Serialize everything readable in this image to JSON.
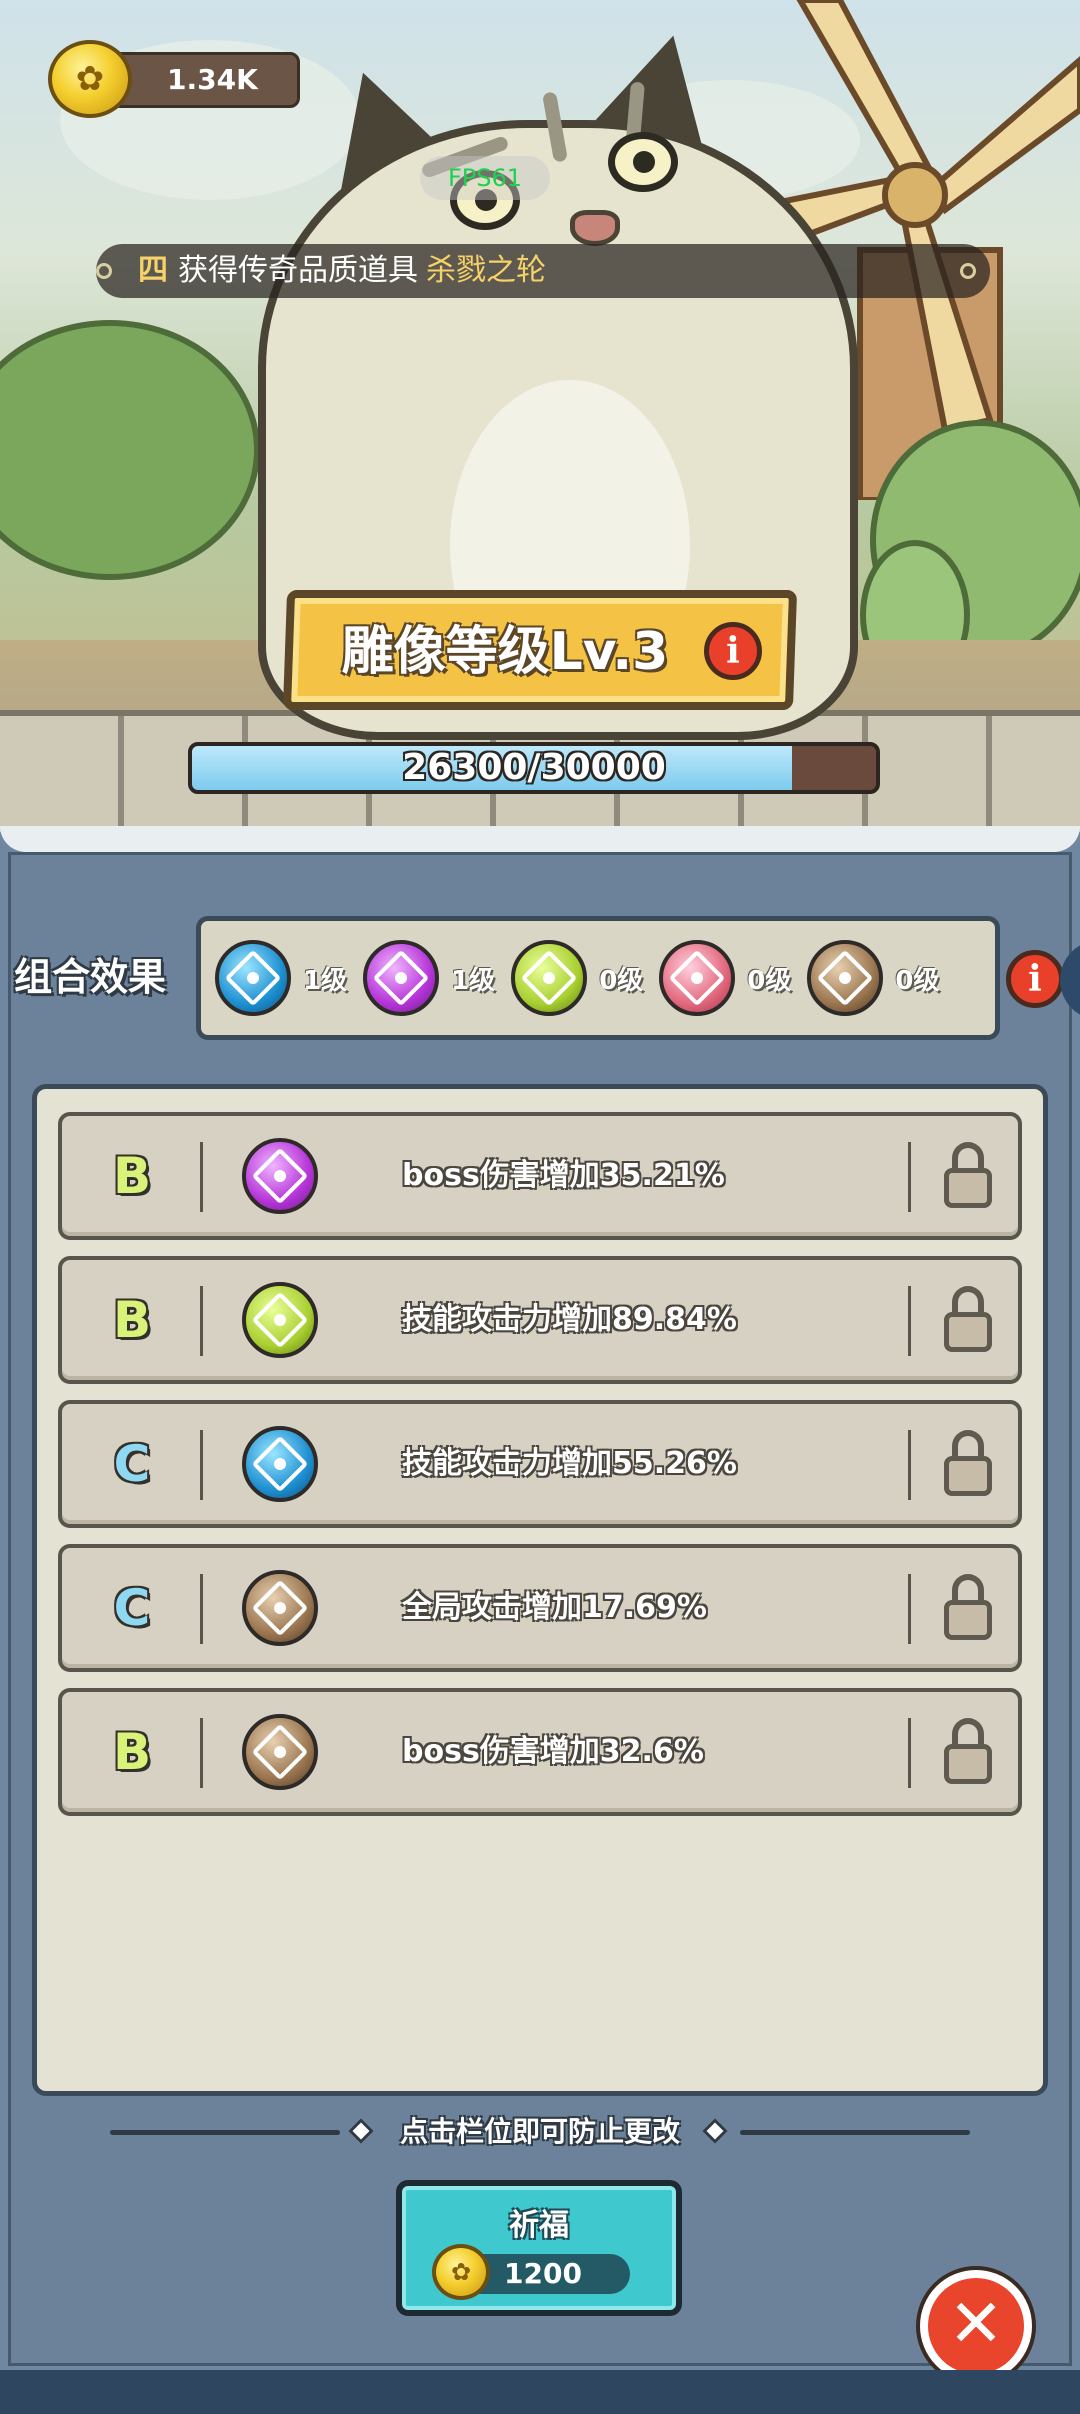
{
  "hud": {
    "coins": "1.34K",
    "fps": "FPS61",
    "notice_index": "四",
    "notice_text": "获得传奇品质道具",
    "notice_item": "杀戮之轮"
  },
  "statue": {
    "level_label": "雕像等级Lv.3",
    "exp_text": "26300/30000",
    "exp_current": 26300,
    "exp_max": 30000,
    "info_icon": "i"
  },
  "combo": {
    "title": "组合效果",
    "items": [
      {
        "icon": "blue-rune-icon",
        "level": "1级"
      },
      {
        "icon": "purple-rune-icon",
        "level": "1级"
      },
      {
        "icon": "green-rune-icon",
        "level": "0级"
      },
      {
        "icon": "pink-rune-icon",
        "level": "0级"
      },
      {
        "icon": "brown-rune-icon",
        "level": "0级"
      }
    ]
  },
  "slots": [
    {
      "grade": "B",
      "rune": "purple",
      "desc": "boss伤害增加35.21%"
    },
    {
      "grade": "B",
      "rune": "green",
      "desc": "技能攻击力增加89.84%"
    },
    {
      "grade": "C",
      "rune": "blue",
      "desc": "技能攻击力增加55.26%"
    },
    {
      "grade": "C",
      "rune": "brown",
      "desc": "全局攻击增加17.69%"
    },
    {
      "grade": "B",
      "rune": "brown",
      "desc": "boss伤害增加32.6%"
    }
  ],
  "hint": "点击栏位即可防止更改",
  "pray": {
    "label": "祈福",
    "cost": "1200"
  },
  "close_symbol": "✕",
  "colors": {
    "gold": "#f4c244",
    "grade_b": "#d8f27a",
    "grade_c": "#8ed8f2",
    "pray_button": "#3fc9cf",
    "close_button": "#e8452c"
  }
}
